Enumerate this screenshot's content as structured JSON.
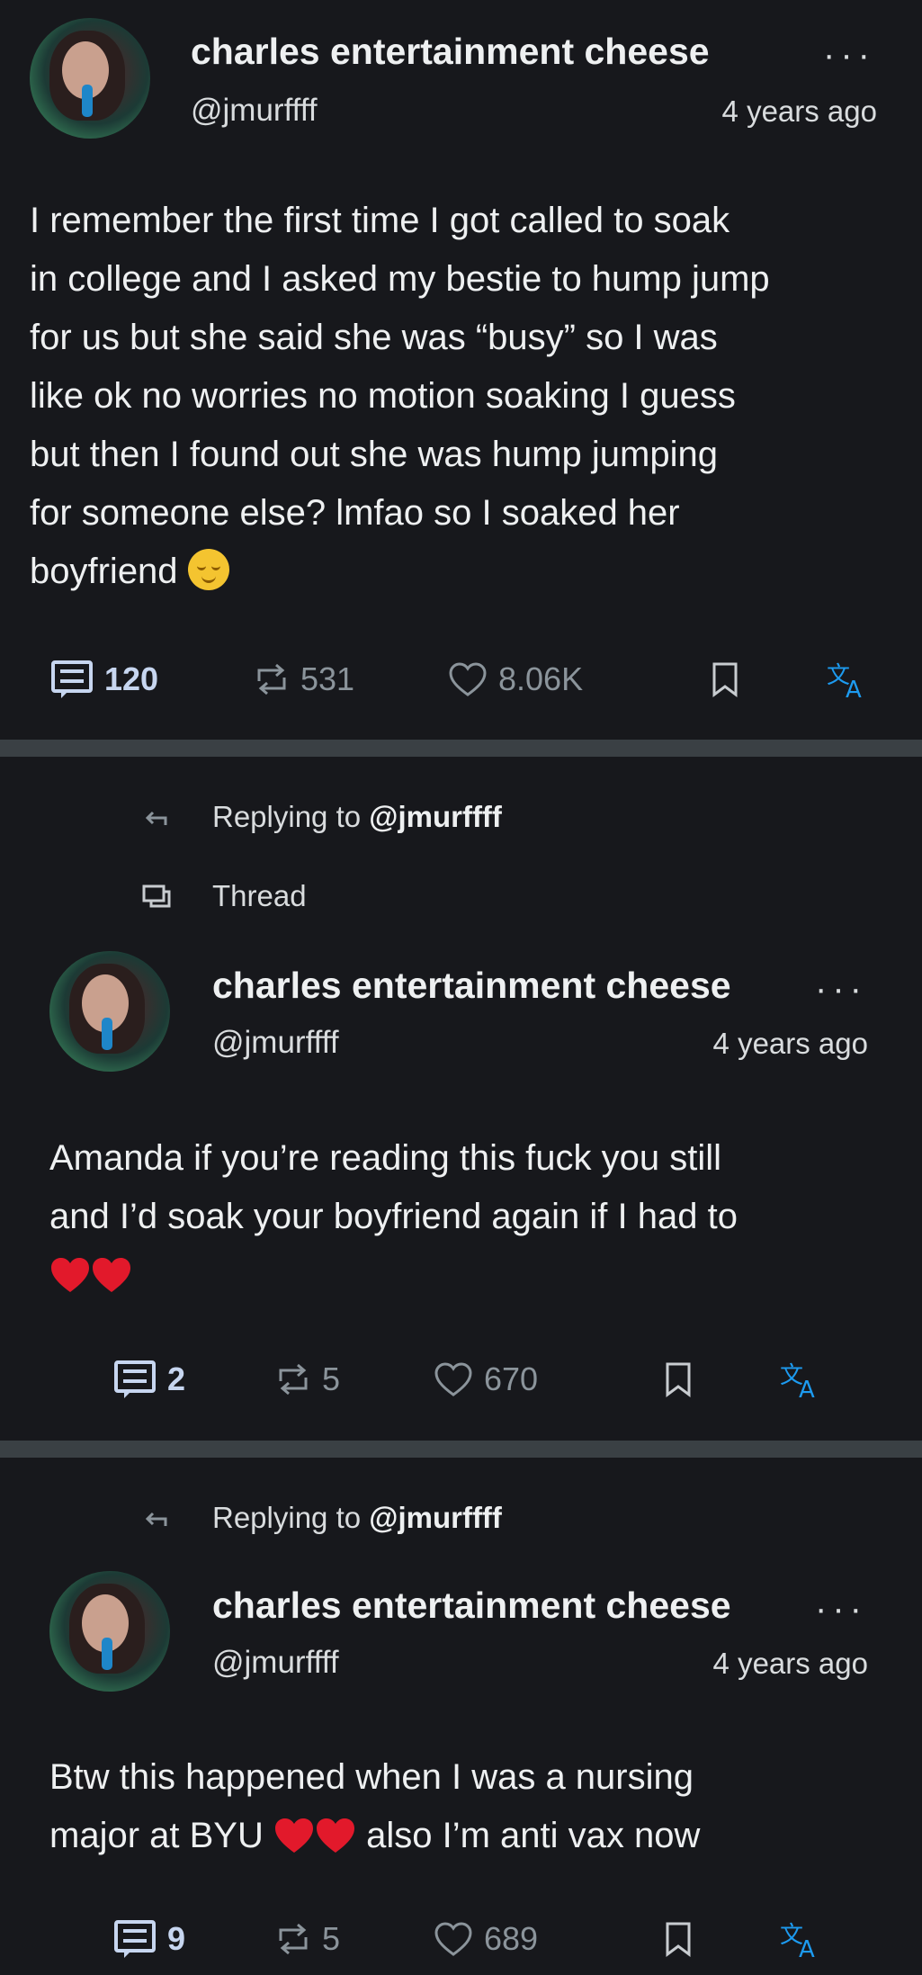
{
  "posts": [
    {
      "name": "charles entertainment cheese",
      "handle": "@jmurffff",
      "time": "4 years ago",
      "text_lines": [
        "I remember the first time I got called to soak",
        "in college and I asked my bestie to hump jump",
        "for us but she said she was “busy” so I was",
        "like ok no worries no motion soaking I guess",
        "but then I found out she was hump jumping",
        "for someone else? lmfao so I soaked her",
        "boyfriend"
      ],
      "emoji": "relieved-face",
      "replies": "120",
      "reposts": "531",
      "likes": "8.06K"
    },
    {
      "replying_prefix": "Replying to ",
      "replying_to": "@jmurffff",
      "thread_label": "Thread",
      "name": "charles entertainment cheese",
      "handle": "@jmurffff",
      "time": "4 years ago",
      "text_lines": [
        "Amanda if you’re reading this fuck you still",
        "and I’d soak your boyfriend again if I had to"
      ],
      "emoji": "two-red-hearts",
      "replies": "2",
      "reposts": "5",
      "likes": "670"
    },
    {
      "replying_prefix": "Replying to ",
      "replying_to": "@jmurffff",
      "name": "charles entertainment cheese",
      "handle": "@jmurffff",
      "time": "4 years ago",
      "text_line1": "Btw this happened when I was a nursing",
      "text_line2_a": "major at BYU",
      "text_line2_b": "also I’m anti vax now",
      "emoji": "two-red-hearts",
      "replies": "9",
      "reposts": "5",
      "likes": "689"
    }
  ],
  "colors": {
    "background": "#17181c",
    "separator": "#3a4044",
    "translate_blue": "#1d9bf0",
    "muted": "#8b949b"
  }
}
